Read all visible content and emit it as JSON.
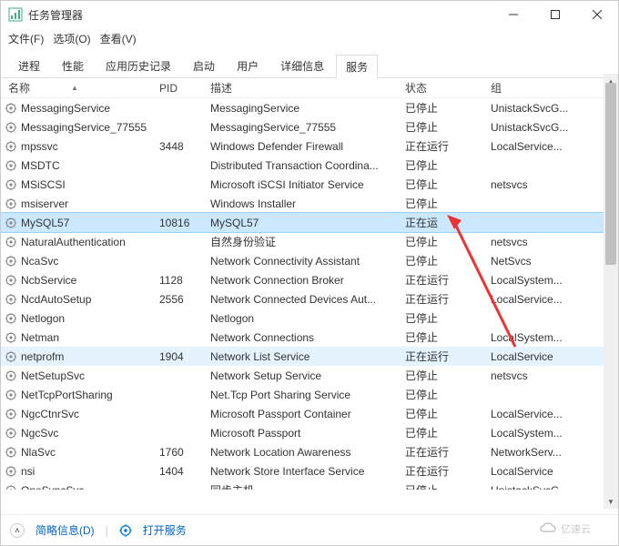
{
  "window": {
    "title": "任务管理器"
  },
  "menu": {
    "file": "文件(F)",
    "options": "选项(O)",
    "view": "查看(V)"
  },
  "tabs": {
    "items": [
      "进程",
      "性能",
      "应用历史记录",
      "启动",
      "用户",
      "详细信息",
      "服务"
    ],
    "active_index": 6
  },
  "columns": {
    "name": "名称",
    "pid": "PID",
    "desc": "描述",
    "status": "状态",
    "group": "组"
  },
  "services": [
    {
      "name": "MessagingService",
      "pid": "",
      "desc": "MessagingService",
      "status": "已停止",
      "group": "UnistackSvcG..."
    },
    {
      "name": "MessagingService_77555",
      "pid": "",
      "desc": "MessagingService_77555",
      "status": "已停止",
      "group": "UnistackSvcG..."
    },
    {
      "name": "mpssvc",
      "pid": "3448",
      "desc": "Windows Defender Firewall",
      "status": "正在运行",
      "group": "LocalService..."
    },
    {
      "name": "MSDTC",
      "pid": "",
      "desc": "Distributed Transaction Coordina...",
      "status": "已停止",
      "group": ""
    },
    {
      "name": "MSiSCSI",
      "pid": "",
      "desc": "Microsoft iSCSI Initiator Service",
      "status": "已停止",
      "group": "netsvcs"
    },
    {
      "name": "msiserver",
      "pid": "",
      "desc": "Windows Installer",
      "status": "已停止",
      "group": ""
    },
    {
      "name": "MySQL57",
      "pid": "10816",
      "desc": "MySQL57",
      "status": "正在运",
      "group": "",
      "selected": true
    },
    {
      "name": "NaturalAuthentication",
      "pid": "",
      "desc": "自然身份验证",
      "status": "已停止",
      "group": "netsvcs"
    },
    {
      "name": "NcaSvc",
      "pid": "",
      "desc": "Network Connectivity Assistant",
      "status": "已停止",
      "group": "NetSvcs"
    },
    {
      "name": "NcbService",
      "pid": "1128",
      "desc": "Network Connection Broker",
      "status": "正在运行",
      "group": "LocalSystem..."
    },
    {
      "name": "NcdAutoSetup",
      "pid": "2556",
      "desc": "Network Connected Devices Aut...",
      "status": "正在运行",
      "group": "LocalService..."
    },
    {
      "name": "Netlogon",
      "pid": "",
      "desc": "Netlogon",
      "status": "已停止",
      "group": ""
    },
    {
      "name": "Netman",
      "pid": "",
      "desc": "Network Connections",
      "status": "已停止",
      "group": "LocalSystem..."
    },
    {
      "name": "netprofm",
      "pid": "1904",
      "desc": "Network List Service",
      "status": "正在运行",
      "group": "LocalService",
      "highlight": true
    },
    {
      "name": "NetSetupSvc",
      "pid": "",
      "desc": "Network Setup Service",
      "status": "已停止",
      "group": "netsvcs"
    },
    {
      "name": "NetTcpPortSharing",
      "pid": "",
      "desc": "Net.Tcp Port Sharing Service",
      "status": "已停止",
      "group": ""
    },
    {
      "name": "NgcCtnrSvc",
      "pid": "",
      "desc": "Microsoft Passport Container",
      "status": "已停止",
      "group": "LocalService..."
    },
    {
      "name": "NgcSvc",
      "pid": "",
      "desc": "Microsoft Passport",
      "status": "已停止",
      "group": "LocalSystem..."
    },
    {
      "name": "NlaSvc",
      "pid": "1760",
      "desc": "Network Location Awareness",
      "status": "正在运行",
      "group": "NetworkServ..."
    },
    {
      "name": "nsi",
      "pid": "1404",
      "desc": "Network Store Interface Service",
      "status": "正在运行",
      "group": "LocalService"
    },
    {
      "name": "OneSyncSvc",
      "pid": "",
      "desc": "同步主机",
      "status": "已停止",
      "group": "UnistackSvcG..."
    }
  ],
  "footer": {
    "brief": "简略信息(D)",
    "open": "打开服务"
  },
  "watermark": "亿速云"
}
